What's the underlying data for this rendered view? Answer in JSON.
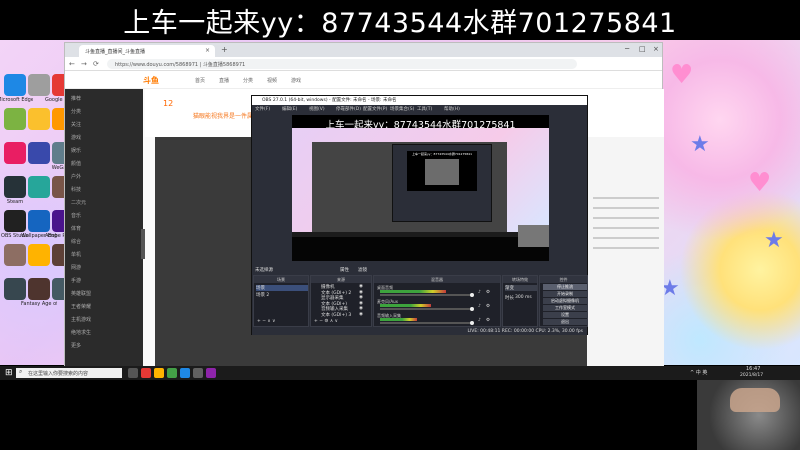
{
  "banner": {
    "text": "上车一起来yy：87743544水群701275841"
  },
  "desktop": {
    "icons": [
      {
        "label": "Microsoft Edge",
        "icon": "edge-icon",
        "color": "#1e88e5"
      },
      {
        "label": "",
        "icon": "recycle-bin-icon",
        "color": "#9e9e9e"
      },
      {
        "label": "Google Chrome",
        "icon": "chrome-icon",
        "color": "#e53935"
      },
      {
        "label": "",
        "icon": "app-icon",
        "color": "#7cb342"
      },
      {
        "label": "",
        "icon": "qq-icon",
        "color": "#fbc02d"
      },
      {
        "label": "",
        "icon": "app-icon",
        "color": "#ff9800"
      },
      {
        "label": "",
        "icon": "app-icon",
        "color": "#e91e63"
      },
      {
        "label": "",
        "icon": "app-icon",
        "color": "#3949ab"
      },
      {
        "label": "WeGame",
        "icon": "wegame-icon",
        "color": "#607d8b"
      },
      {
        "label": "Steam",
        "icon": "steam-icon",
        "color": "#263238"
      },
      {
        "label": "",
        "icon": "app-icon",
        "color": "#26a69a"
      },
      {
        "label": "",
        "icon": "app-icon",
        "color": "#795548"
      },
      {
        "label": "OBS Studio",
        "icon": "obs-icon",
        "color": "#212121"
      },
      {
        "label": "Wallpaper Engine",
        "icon": "wallpaper-engine-icon",
        "color": "#1565c0"
      },
      {
        "label": "Adobe Premiere",
        "icon": "premiere-icon",
        "color": "#4a148c"
      },
      {
        "label": "",
        "icon": "app-icon",
        "color": "#8d6e63"
      },
      {
        "label": "",
        "icon": "app-icon",
        "color": "#ffb300"
      },
      {
        "label": "",
        "icon": "app-icon",
        "color": "#5d4037"
      },
      {
        "label": "",
        "icon": "app-icon",
        "color": "#37474f"
      },
      {
        "label": "Fantasy Age of Valor",
        "icon": "game-icon",
        "color": "#4e342e"
      },
      {
        "label": "",
        "icon": "app-icon",
        "color": "#455a64"
      }
    ]
  },
  "browser": {
    "tab_title": "斗鱼直播_直播间_斗鱼直播",
    "tab_close": "×",
    "new_tab": "+",
    "controls": {
      "minimize": "─",
      "maximize": "□",
      "close": "×"
    },
    "nav": {
      "back": "←",
      "forward": "→",
      "refresh": "⟳"
    },
    "url": "https://www.douyu.com/5868971 | 斗鱼直播5868971",
    "logo": "斗鱼",
    "top_nav": [
      "首页",
      "直播",
      "分类",
      "视频",
      "游戏"
    ],
    "sidebar_items": [
      "推荐",
      "分类",
      "关注",
      "游戏",
      "娱乐",
      "颜值",
      "户外",
      "科技",
      "二次元",
      "音乐",
      "体育",
      "综合",
      "单机",
      "网游",
      "手游",
      "英雄联盟",
      "王者荣耀",
      "主机游戏",
      "绝地求生",
      "更多"
    ],
    "follow_count": "12",
    "room_title": "猫眼能视我界是一件属"
  },
  "obs": {
    "title": "OBS 27.0.1 (64-bit, windows) - 配置文件: 未命名 - 场景: 未命名",
    "menu": [
      "文件(F)",
      "编辑(E)",
      "视图(V)",
      "停靠部件(D)",
      "配置文件(P)",
      "场景集合(S)",
      "工具(T)",
      "帮助(H)"
    ],
    "preview_banner": "上车一起来yy：87743544水群701275841",
    "scene_bar_label": "未选择源",
    "scene_bar_tabs": [
      "属性",
      "滤镜"
    ],
    "docks": {
      "scenes": {
        "title": "场景",
        "items": [
          "场景",
          "场景 2"
        ]
      },
      "sources": {
        "title": "来源",
        "items": [
          "摄像机",
          "文本 (GDI+) 2",
          "显示器采集",
          "文本 (GDI+)",
          "音频输入采集",
          "文本 (GDI+) 3"
        ]
      },
      "mixer": {
        "title": "混音器",
        "channels": [
          {
            "name": "桌面音频",
            "level": 0.72
          },
          {
            "name": "麦克风/Aux",
            "level": 0.55
          },
          {
            "name": "音频输入采集",
            "level": 0.4
          }
        ]
      },
      "transitions": {
        "title": "转场特效",
        "selected": "渐变",
        "duration_label": "时长",
        "duration": "300 ms"
      },
      "controls": {
        "title": "控件",
        "buttons": [
          "停止推流",
          "开始录制",
          "启动虚拟摄像机",
          "工作室模式",
          "设置",
          "退出"
        ]
      }
    },
    "status": "LIVE: 00:48:11  REC: 00:00:00  CPU: 2.3%, 30.00 fps"
  },
  "taskbar": {
    "start": "⊞",
    "search_placeholder": "在这里输入你要搜索的内容",
    "apps": [
      {
        "icon": "task-view-icon",
        "color": "#555"
      },
      {
        "icon": "browser-icon",
        "color": "#e53935"
      },
      {
        "icon": "game-icon",
        "color": "#ffb300"
      },
      {
        "icon": "chrome-icon",
        "color": "#43a047"
      },
      {
        "icon": "app-icon",
        "color": "#1e88e5"
      },
      {
        "icon": "obs-icon",
        "color": "#616161"
      },
      {
        "icon": "app-icon",
        "color": "#8e24aa"
      }
    ],
    "tray_text": "^ 中 英",
    "time": "16:47",
    "date": "2021/8/17"
  }
}
